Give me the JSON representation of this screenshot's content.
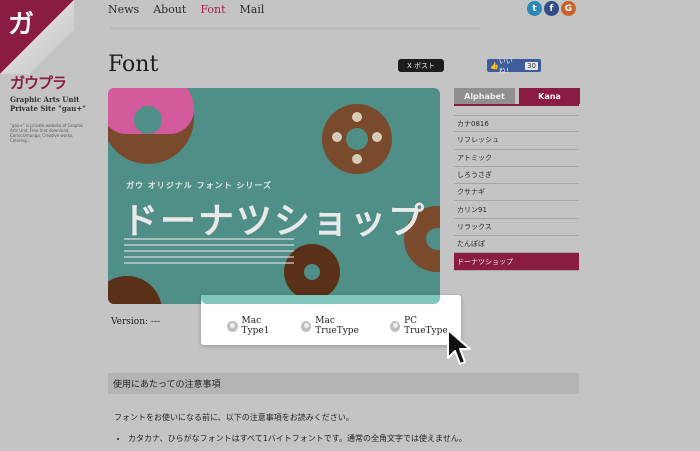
{
  "brand": {
    "corner_glyph": "ガ",
    "logo": "ガウプラ",
    "subtitle_1": "Graphic Arts Unit",
    "subtitle_2": "Private Site \"gau+\"",
    "description": "\"gau+\" is private website of Graphic Arts Unit. Free font download, Comics/manga, Creative works, Coloring..."
  },
  "nav": {
    "items": [
      {
        "label": "News",
        "active": false
      },
      {
        "label": "About",
        "active": false
      },
      {
        "label": "Font",
        "active": true
      },
      {
        "label": "Mail",
        "active": false
      }
    ]
  },
  "social": {
    "twitter": "t",
    "facebook": "f",
    "gplus": "G"
  },
  "page": {
    "title": "Font",
    "xpost_label": "X ポスト",
    "like_label": "いいね！",
    "like_count": "30"
  },
  "hero": {
    "caption": "ガウ オリジナル フォント シリーズ",
    "title": "ドーナツショップ"
  },
  "version": "Version: ---",
  "download_popup": {
    "options": [
      {
        "label": "Mac Type1"
      },
      {
        "label": "Mac TrueType"
      },
      {
        "label": "PC TrueType"
      }
    ]
  },
  "sidebar": {
    "tabs": [
      {
        "label": "Alphabet",
        "active": false
      },
      {
        "label": "Kana",
        "active": true
      }
    ],
    "fonts": [
      {
        "label": "カナ0816",
        "selected": false
      },
      {
        "label": "リフレッシュ",
        "selected": false
      },
      {
        "label": "アトミック",
        "selected": false
      },
      {
        "label": "しろうさぎ",
        "selected": false
      },
      {
        "label": "クサナギ",
        "selected": false
      },
      {
        "label": "カリン91",
        "selected": false
      },
      {
        "label": "リラックス",
        "selected": false
      },
      {
        "label": "たんぽぽ",
        "selected": false
      },
      {
        "label": "ドーナツショップ",
        "selected": true
      }
    ]
  },
  "notes": {
    "heading": "使用にあたっての注意事項",
    "intro": "フォントをお使いになる前に、以下の注意事項をお読みください。",
    "items": [
      "カタカナ、ひらがなフォントはすべて1バイトフォントです。通常の全角文字では使えません。"
    ]
  },
  "colors": {
    "accent": "#8a1c43",
    "hero_bg": "#4f8f88"
  }
}
